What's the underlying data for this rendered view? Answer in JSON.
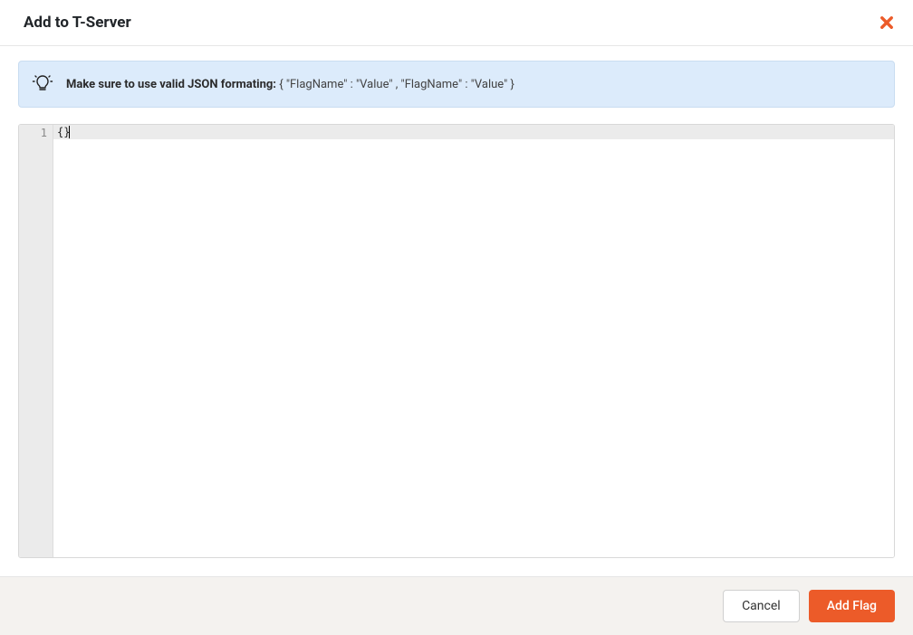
{
  "header": {
    "title": "Add to T-Server"
  },
  "banner": {
    "bold": "Make sure to use valid JSON formating:",
    "example": "{ \"FlagName\" : \"Value\" , \"FlagName\" : \"Value\" }"
  },
  "editor": {
    "line_number": "1",
    "content": "{}"
  },
  "footer": {
    "cancel_label": "Cancel",
    "add_label": "Add Flag"
  }
}
